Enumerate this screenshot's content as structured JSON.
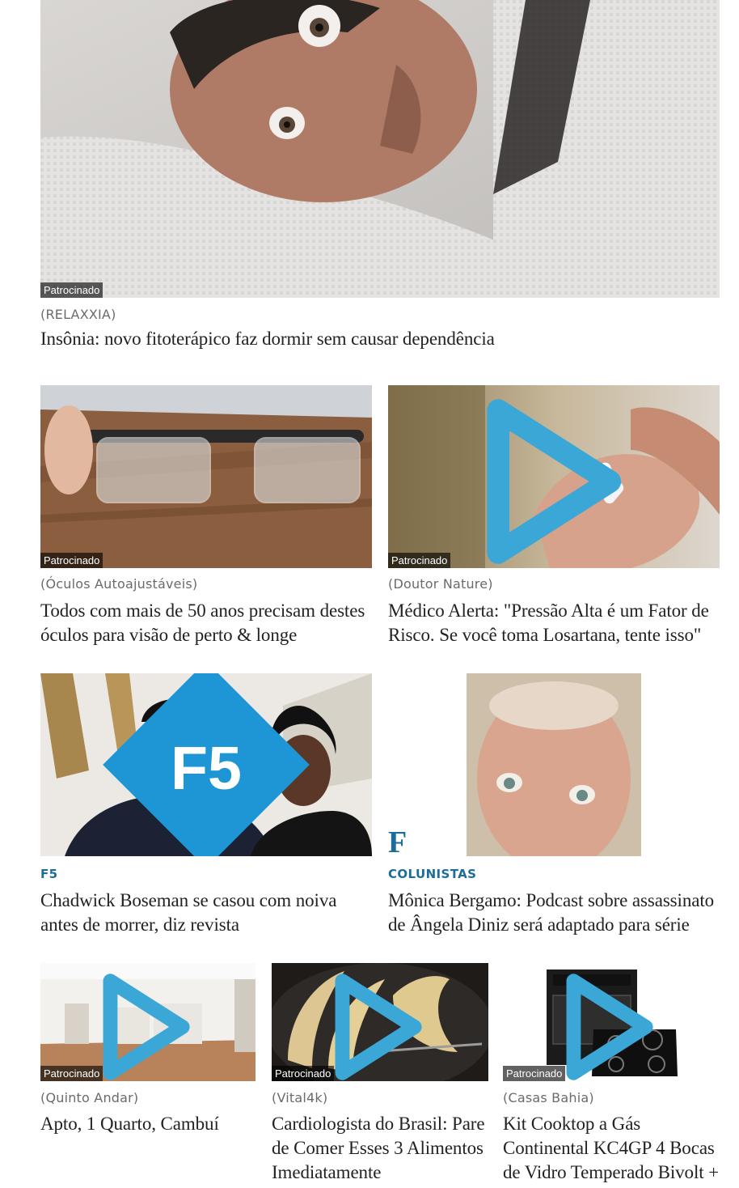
{
  "badge_label": "Patrocinado",
  "cards": {
    "insomnia": {
      "source": "(RELAXXIA)",
      "headline": "Insônia: novo fitoterápico faz dormir sem causar dependência"
    },
    "glasses": {
      "source": "(Óculos Autoajustáveis)",
      "headline": "Todos com mais de 50 anos precisam destes óculos para visão de perto & longe"
    },
    "pills": {
      "source": "(Doutor Nature)",
      "headline": "Médico Alerta: \"Pressão Alta é um Fator de Risco. Se você toma Losartana, tente isso\""
    },
    "chadwick": {
      "kicker": "F5",
      "headline": "Chadwick Boseman se casou com noiva antes de morrer, diz revista",
      "logo_text": "F5"
    },
    "monica": {
      "kicker": "COLUNISTAS",
      "headline": "Mônica Bergamo: Podcast sobre assassinato de Ângela Diniz será adaptado para série",
      "logo_text": "F"
    },
    "apto": {
      "source": "(Quinto Andar)",
      "headline": "Apto, 1 Quarto, Cambuí"
    },
    "bananas": {
      "source": "(Vital4k)",
      "headline": "Cardiologista do Brasil: Pare de Comer Esses 3 Alimentos Imediatamente"
    },
    "cooktop": {
      "source": "(Casas Bahia)",
      "headline": "Kit Cooktop a Gás Continental KC4GP 4 Bocas de Vidro Temperado Bivolt +"
    }
  },
  "colors": {
    "accent": "#1c6d99",
    "text": "#222222",
    "source": "#6b6b6b"
  }
}
